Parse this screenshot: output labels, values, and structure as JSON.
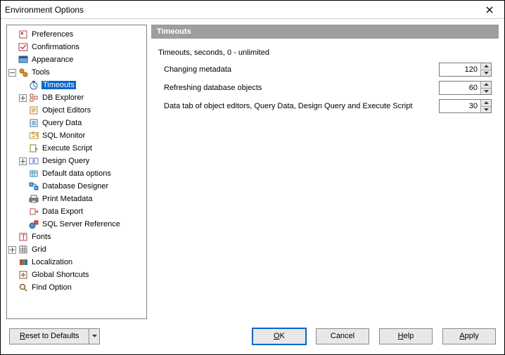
{
  "window": {
    "title": "Environment Options"
  },
  "tree": {
    "preferences": "Preferences",
    "confirmations": "Confirmations",
    "appearance": "Appearance",
    "tools": "Tools",
    "timeouts": "Timeouts",
    "db_explorer": "DB Explorer",
    "object_editors": "Object Editors",
    "query_data": "Query Data",
    "sql_monitor": "SQL Monitor",
    "execute_script": "Execute Script",
    "design_query": "Design Query",
    "default_data_options": "Default data options",
    "database_designer": "Database Designer",
    "print_metadata": "Print Metadata",
    "data_export": "Data Export",
    "sql_server_ref": "SQL Server Reference",
    "fonts": "Fonts",
    "grid": "Grid",
    "localization": "Localization",
    "global_shortcuts": "Global Shortcuts",
    "find_option": "Find Option"
  },
  "panel": {
    "header": "Timeouts",
    "group": "Timeouts, seconds, 0 - unlimited",
    "changing_metadata_label": "Changing metadata",
    "changing_metadata_value": "120",
    "refreshing_label": "Refreshing database objects",
    "refreshing_value": "60",
    "datatab_label": "Data tab of object editors, Query Data, Design Query and Execute Script",
    "datatab_value": "30"
  },
  "buttons": {
    "reset": "Reset to Defaults",
    "ok": "OK",
    "cancel": "Cancel",
    "help": "Help",
    "apply": "Apply"
  }
}
